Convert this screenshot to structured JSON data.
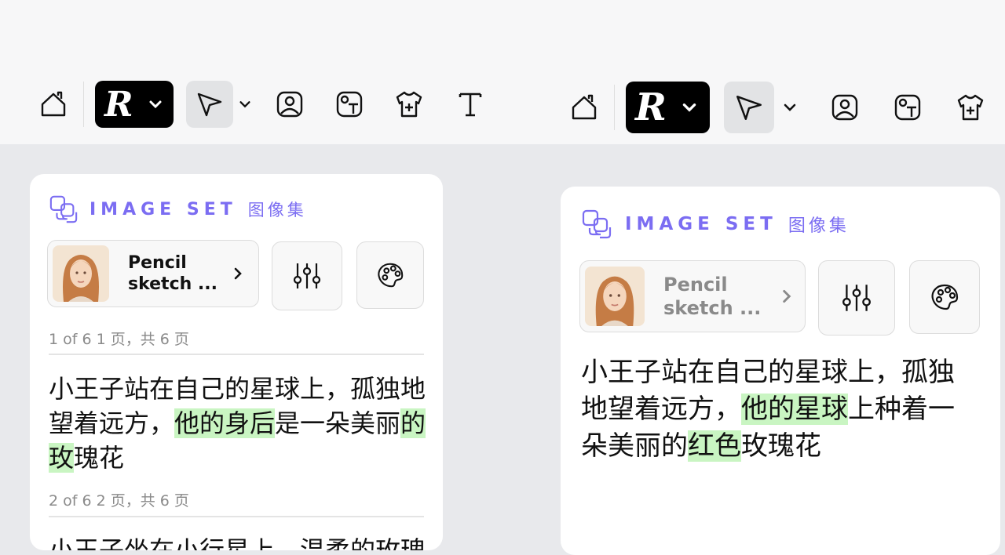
{
  "toolbar": {
    "tools": [
      "home-icon",
      "logo-button",
      "select-tool",
      "image-tool",
      "text-image-tool",
      "apparel-tool",
      "text-tool"
    ]
  },
  "left_panel": {
    "header_title": "IMAGE SET",
    "header_subtitle": "图像集",
    "style_label_line1": "Pencil",
    "style_label_line2": "sketch ...",
    "entries": [
      {
        "page_label": "1 of 6 1 页，共 6 页",
        "text_before": "小王子站在自己的星球上，孤独地望着远方，",
        "text_hl1": "他的身后",
        "text_mid": "是一朵美丽",
        "text_hl2": "的玫",
        "text_after": "瑰花"
      },
      {
        "page_label": "2 of 6 2 页，共 6 页",
        "text_partial": "小王子坐在小行星上，温柔的玫瑰"
      }
    ]
  },
  "right_panel": {
    "header_title": "IMAGE SET",
    "header_subtitle": "图像集",
    "style_label_line1": "Pencil",
    "style_label_line2": "sketch ...",
    "text_before": "小王子站在自己的星球上，孤独地望着远方，",
    "text_hl1": "他的星球",
    "text_mid": "上种着一朵美丽的",
    "text_hl2": "红色",
    "text_after": "玫瑰花"
  },
  "colors": {
    "accent": "#7b6df2",
    "highlight": "#c9f5c2",
    "logo_bg": "#000000"
  }
}
